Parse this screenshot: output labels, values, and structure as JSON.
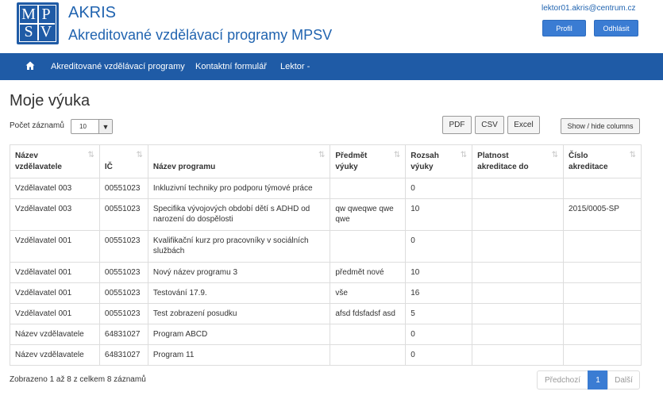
{
  "header": {
    "logo_letters": [
      "M",
      "P",
      "S",
      "V"
    ],
    "title": "AKRIS",
    "subtitle": "Akreditované vzdělávací programy MPSV",
    "user_email": "lektor01.akris@centrum.cz",
    "profile_label": "Profil",
    "logout_label": "Odhlásit"
  },
  "nav": {
    "home_icon": "home-icon",
    "items": [
      "Akreditované vzdělávací programy",
      "Kontaktní formulář",
      "Lektor -"
    ]
  },
  "page": {
    "title": "Moje výuka",
    "records_label": "Počet záznamů",
    "records_value": "10"
  },
  "toolbar": {
    "pdf": "PDF",
    "csv": "CSV",
    "excel": "Excel",
    "columns": "Show / hide columns"
  },
  "table": {
    "columns": [
      [
        "Název",
        "vzdělavatele"
      ],
      [
        "IČ"
      ],
      [
        "Název programu"
      ],
      [
        "Předmět",
        "výuky"
      ],
      [
        "Rozsah",
        "výuky"
      ],
      [
        "Platnost",
        "akreditace do"
      ],
      [
        "Číslo",
        "akreditace"
      ]
    ],
    "rows": [
      [
        "Vzdělavatel 003",
        "00551023",
        "Inkluzivní techniky pro podporu týmové práce",
        "",
        "0",
        "",
        ""
      ],
      [
        "Vzdělavatel 003",
        "00551023",
        "Specifika vývojových období dětí s ADHD od narození do dospělosti",
        "qw qweqwe qwe qwe",
        "10",
        "",
        "2015/0005-SP"
      ],
      [
        "Vzdělavatel 001",
        "00551023",
        "Kvalifikační kurz pro pracovníky v sociálních službách",
        "",
        "0",
        "",
        ""
      ],
      [
        "Vzdělavatel 001",
        "00551023",
        "Nový název programu 3",
        "předmět nové",
        "10",
        "",
        ""
      ],
      [
        "Vzdělavatel 001",
        "00551023",
        "Testování 17.9.",
        "vše",
        "16",
        "",
        ""
      ],
      [
        "Vzdělavatel 001",
        "00551023",
        "Test zobrazení posudku",
        "afsd fdsfadsf asd",
        "5",
        "",
        ""
      ],
      [
        "Název vzdělavatele",
        "64831027",
        "Program ABCD",
        "",
        "0",
        "",
        ""
      ],
      [
        "Název vzdělavatele",
        "64831027",
        "Program 11",
        "",
        "0",
        "",
        ""
      ]
    ]
  },
  "footer": {
    "summary": "Zobrazeno 1 až 8 z celkem 8 záznamů",
    "prev": "Předchozí",
    "current_page": "1",
    "next": "Další"
  },
  "colors": {
    "brand": "#1f5ba6",
    "button": "#3a7cd3"
  }
}
